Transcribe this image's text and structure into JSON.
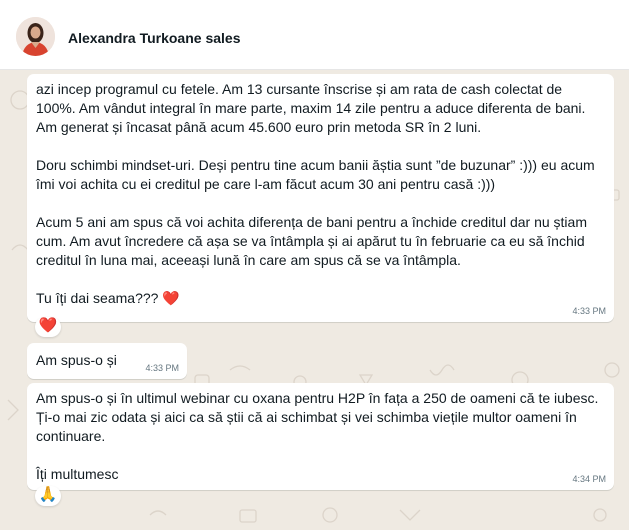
{
  "header": {
    "contact_name": "Alexandra Turkoane sales",
    "avatar_icon": "profile-photo"
  },
  "messages": [
    {
      "text": "azi incep programul cu fetele. Am 13 cursante înscrise și am rata de cash colectat de 100%. Am vândut integral în mare parte, maxim 14 zile pentru a aduce diferenta de bani. Am generat și încasat până acum 45.600 euro prin metoda SR în 2 luni.\n\nDoru schimbi mindset-uri. Deși pentru tine acum banii ăștia sunt ”de buzunar” :))) eu acum îmi voi achita cu ei creditul pe care l-am făcut acum 30 ani pentru casă :)))\n\nAcum 5 ani am spus că voi achita diferența de bani pentru a închide creditul dar nu știam cum. Am avut încredere că așa se va întâmpla și ai apărut tu în februarie ca eu să închid creditul în luna mai, aceeași lună în care am spus că se va întâmpla.\n\nTu îți dai seama??? ❤️",
      "time": "4:33 PM",
      "reaction": "❤️"
    },
    {
      "text": "Am spus-o și",
      "time": "4:33 PM"
    },
    {
      "text": "Am spus-o și în ultimul webinar cu oxana pentru H2P în fața a 250 de oameni că te iubesc. Ți-o mai zic odata și aici ca să știi că ai schimbat și vei schimba viețile multor oameni în continuare.\n\nÎți multumesc",
      "time": "4:34 PM",
      "reaction": "🙏"
    }
  ],
  "colors": {
    "chat_background": "#efeae2",
    "bubble": "#ffffff",
    "text": "#111b21",
    "timestamp": "#667781"
  }
}
